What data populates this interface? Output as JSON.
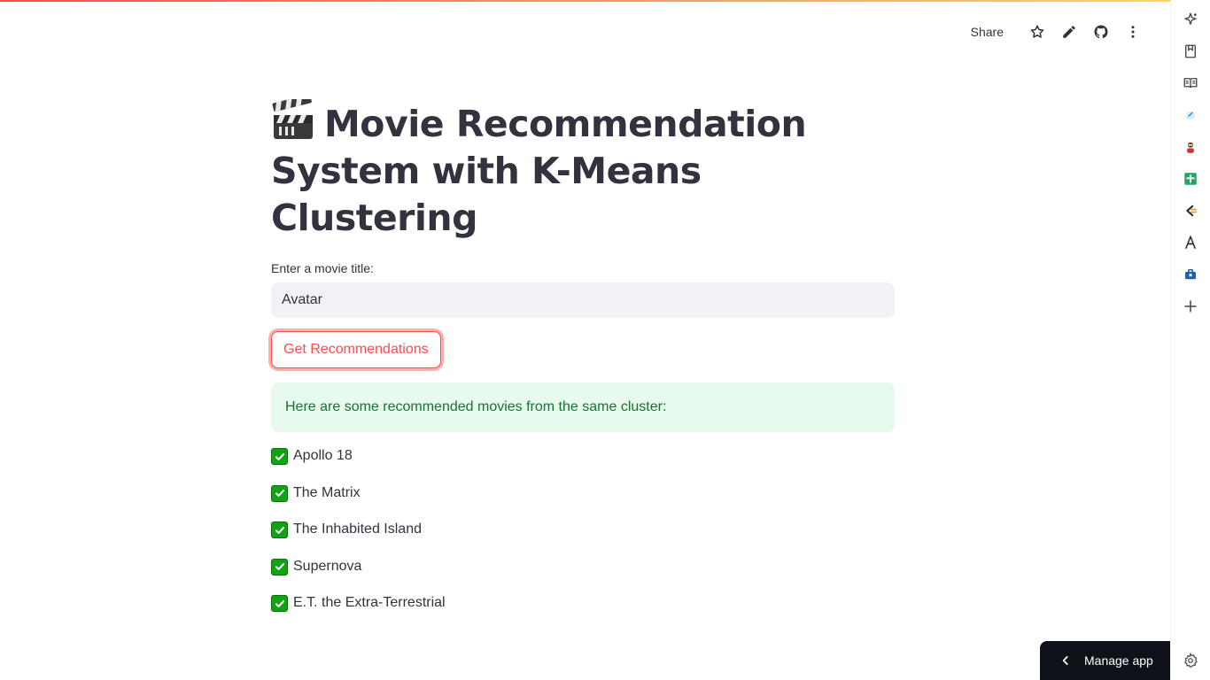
{
  "header": {
    "share_label": "Share",
    "icons": [
      "star-icon",
      "pencil-icon",
      "github-icon",
      "more-vertical-icon"
    ]
  },
  "main": {
    "title_icon": "clapper-board-icon",
    "title": "Movie Recommendation System with K-Means Clustering",
    "input_label": "Enter a movie title:",
    "input_value": "Avatar",
    "button_label": "Get Recommendations",
    "success_message": "Here are some recommended movies from the same cluster:",
    "recommendations": [
      "Apollo 18",
      "The Matrix",
      "The Inhabited Island",
      "Supernova",
      "E.T. the Extra-Terrestrial"
    ]
  },
  "footer": {
    "manage_label": "Manage app"
  },
  "side_rail": {
    "icons": [
      "sparkle-icon",
      "bookmark-icon",
      "reader-icon",
      "note-icon",
      "avatar-icon",
      "sheets-icon",
      "slides-icon",
      "font-icon",
      "briefcase-icon",
      "plus-icon",
      "settings-icon"
    ]
  },
  "colors": {
    "accent": "#ff4b4b",
    "success_bg": "#e8f9ee",
    "success_text": "#177233",
    "text": "#31333f",
    "input_bg": "#f0f2f6",
    "manage_bg": "#0e1117"
  }
}
